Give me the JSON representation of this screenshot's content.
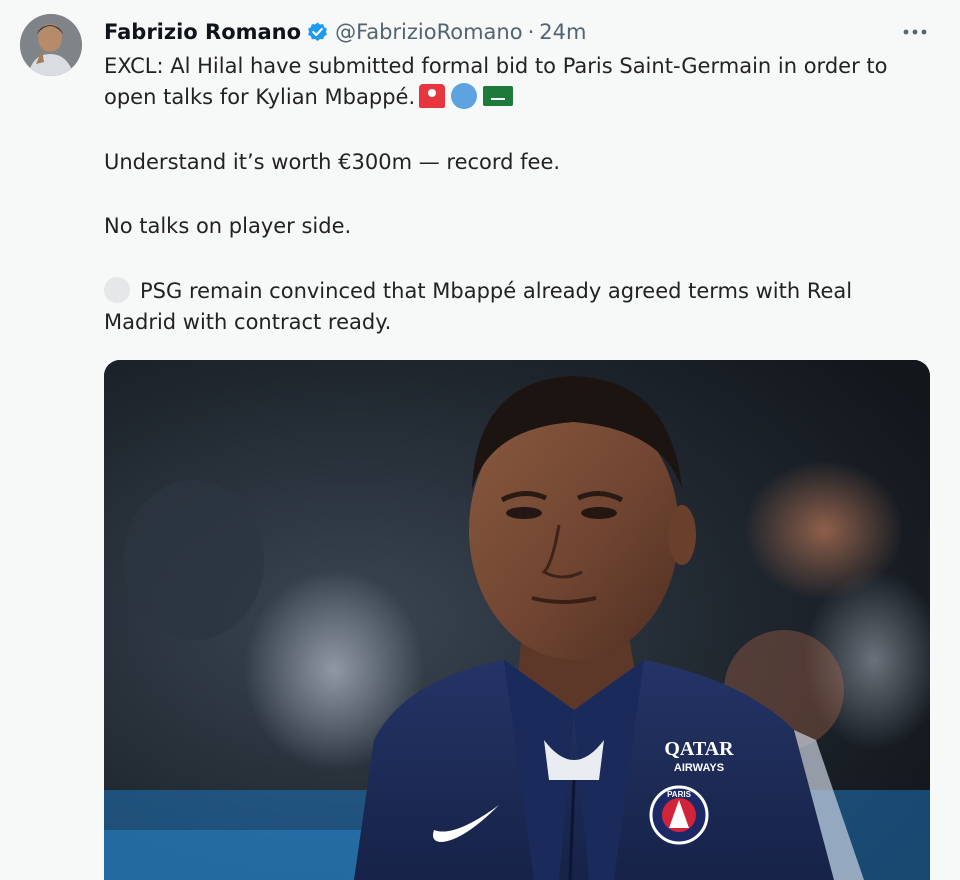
{
  "tweet": {
    "author_name": "Fabrizio Romano",
    "handle": "@FabrizioRomano",
    "separator": "·",
    "time": "24m",
    "line1": "EXCL: Al Hilal have submitted formal bid to Paris Saint-Germain in order to",
    "line2": "open talks for Kylian Mbappé.",
    "para2": "Understand it’s worth €300m — record fee.",
    "para3": "No talks on player side.",
    "para4_line1": "PSG remain convinced that Mbappé already agreed terms with Real",
    "para4_line2": "Madrid with contract ready.",
    "emojis": [
      "rotating-light",
      "blue-circle",
      "saudi-arabia-flag",
      "white-circle"
    ]
  },
  "media": {
    "sponsor_line1": "QATAR",
    "sponsor_line2": "AIRWAYS",
    "crest_text": "PARIS"
  },
  "colors": {
    "verified": "#1d9bf0",
    "secondary_text": "#536471",
    "background": "#f7f8f8",
    "jacket": "#1d2b5c"
  }
}
